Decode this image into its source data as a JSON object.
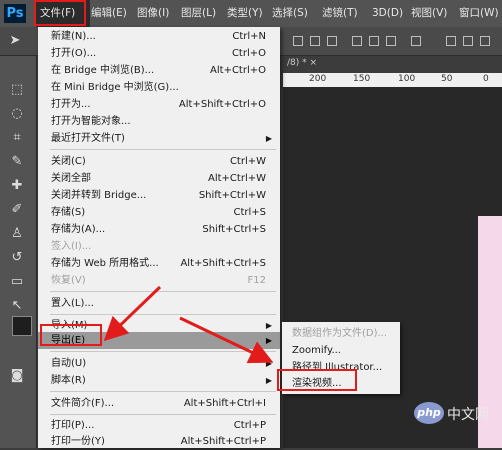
{
  "app": {
    "logo": "Ps"
  },
  "menubar": [
    {
      "label": "文件(F)",
      "active": true
    },
    {
      "label": "编辑(E)"
    },
    {
      "label": "图像(I)"
    },
    {
      "label": "图层(L)"
    },
    {
      "label": "类型(Y)"
    },
    {
      "label": "选择(S)"
    },
    {
      "label": "滤镜(T)"
    },
    {
      "label": "3D(D)"
    },
    {
      "label": "视图(V)"
    },
    {
      "label": "窗口(W)"
    }
  ],
  "document": {
    "tab_fragment": "/8) * ×",
    "ruler_ticks": [
      "200",
      "150",
      "100",
      "50",
      "0"
    ]
  },
  "file_menu": {
    "new": {
      "label": "新建(N)...",
      "shortcut": "Ctrl+N"
    },
    "open": {
      "label": "打开(O)...",
      "shortcut": "Ctrl+O"
    },
    "browse_bridge": {
      "label": "在 Bridge 中浏览(B)...",
      "shortcut": "Alt+Ctrl+O"
    },
    "browse_mini_bridge": {
      "label": "在 Mini Bridge 中浏览(G)..."
    },
    "open_as": {
      "label": "打开为...",
      "shortcut": "Alt+Shift+Ctrl+O"
    },
    "open_smart": {
      "label": "打开为智能对象..."
    },
    "recent": {
      "label": "最近打开文件(T)"
    },
    "close": {
      "label": "关闭(C)",
      "shortcut": "Ctrl+W"
    },
    "close_all": {
      "label": "关闭全部",
      "shortcut": "Alt+Ctrl+W"
    },
    "close_bridge": {
      "label": "关闭并转到 Bridge...",
      "shortcut": "Shift+Ctrl+W"
    },
    "save": {
      "label": "存储(S)",
      "shortcut": "Ctrl+S"
    },
    "save_as": {
      "label": "存储为(A)...",
      "shortcut": "Shift+Ctrl+S"
    },
    "checkin": {
      "label": "签入(I)..."
    },
    "save_web": {
      "label": "存储为 Web 所用格式...",
      "shortcut": "Alt+Shift+Ctrl+S"
    },
    "revert": {
      "label": "恢复(V)",
      "shortcut": "F12"
    },
    "place": {
      "label": "置入(L)..."
    },
    "import": {
      "label": "导入(M)"
    },
    "export": {
      "label": "导出(E)"
    },
    "automate": {
      "label": "自动(U)"
    },
    "scripts": {
      "label": "脚本(R)"
    },
    "file_info": {
      "label": "文件简介(F)...",
      "shortcut": "Alt+Shift+Ctrl+I"
    },
    "print": {
      "label": "打印(P)...",
      "shortcut": "Ctrl+P"
    },
    "print_one": {
      "label": "打印一份(Y)",
      "shortcut": "Alt+Shift+Ctrl+P"
    }
  },
  "export_submenu": {
    "data_sets": "数据组作为文件(D)...",
    "zoomify": "Zoomify...",
    "paths_illustrator": "路径到 Illustrator...",
    "render_video": "渲染视频..."
  },
  "watermark": {
    "badge": "php",
    "site": "中文网"
  },
  "colors": {
    "annotation": "#e21b1b",
    "menu_bg": "#f0f0f0",
    "highlight": "#9a9a9a"
  }
}
